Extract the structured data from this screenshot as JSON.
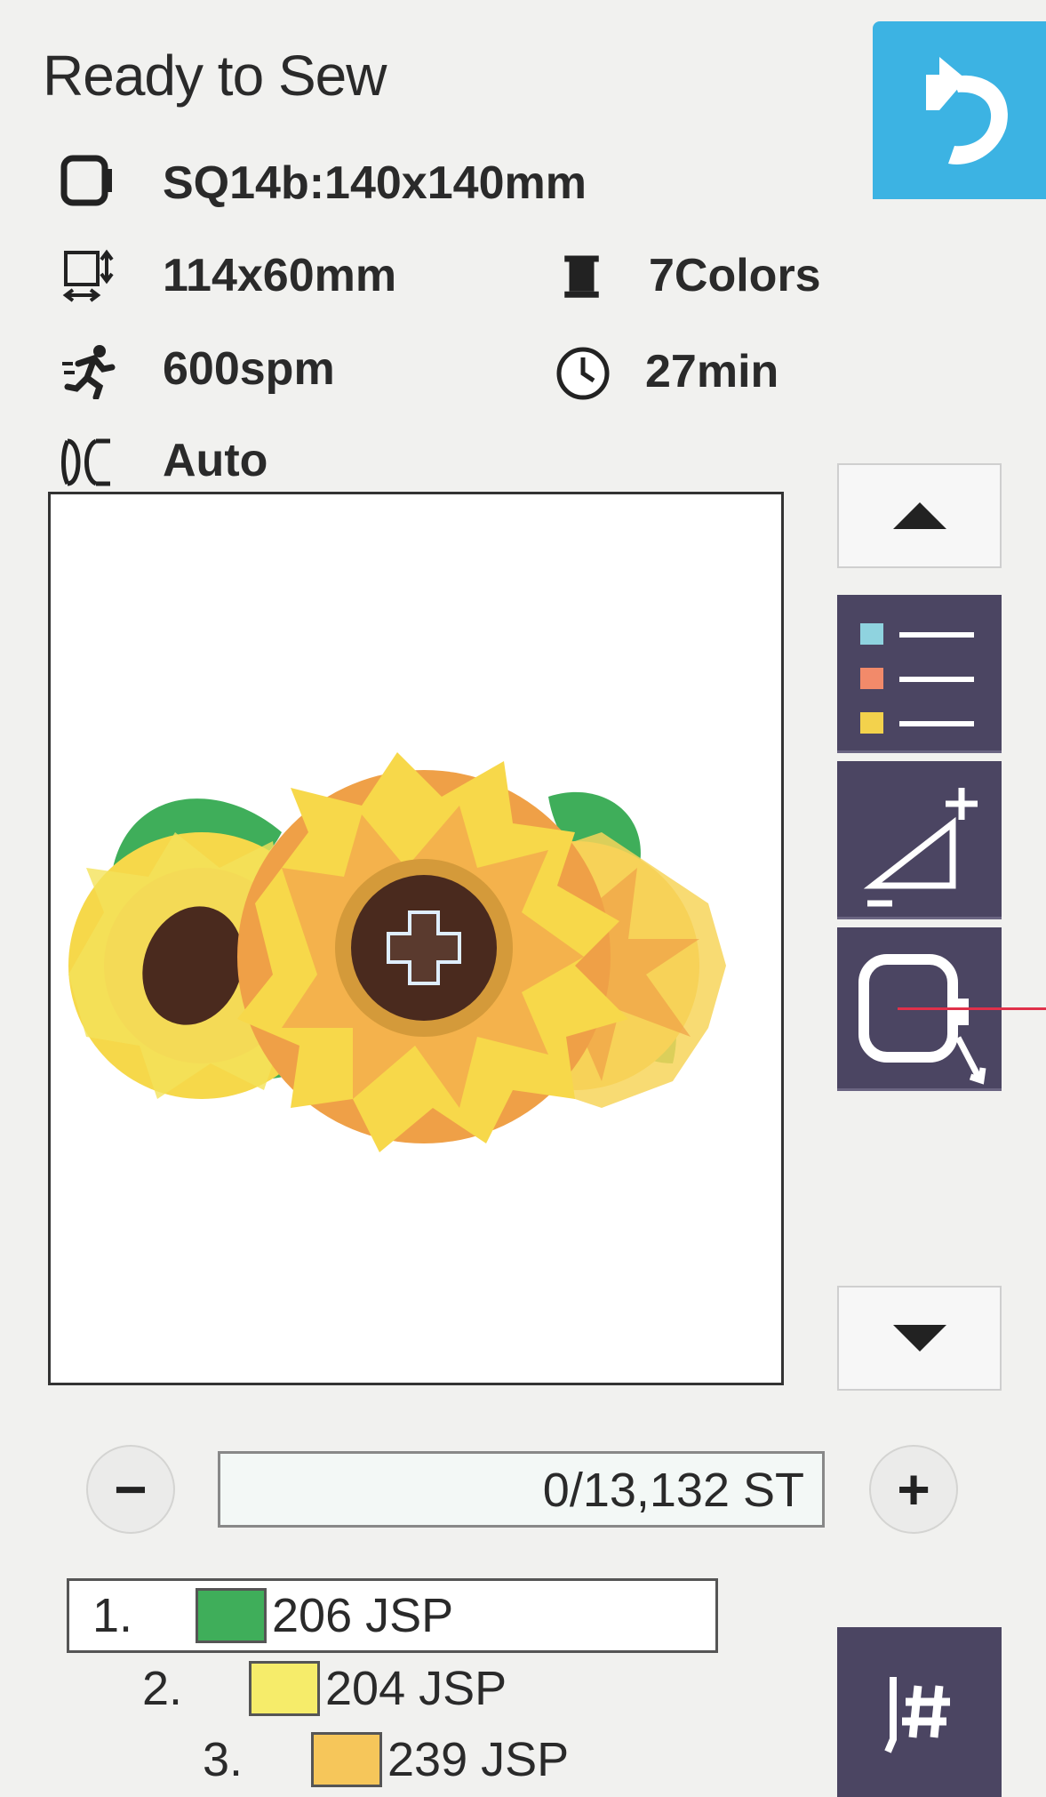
{
  "screen": {
    "title": "Ready to Sew"
  },
  "info": {
    "hoop": "SQ14b:140x140mm",
    "design_size": "114x60mm",
    "colors": "7Colors",
    "speed": "600spm",
    "time": "27min",
    "thread_cut": "Auto"
  },
  "stitch_counter": {
    "value": "0/13,132 ST",
    "minus_label": "−",
    "plus_label": "+"
  },
  "thread_list": [
    {
      "index": "1.",
      "code": "206 JSP",
      "color": "#3fae5a",
      "selected": true
    },
    {
      "index": "2.",
      "code": "204 JSP",
      "color": "#f6ec6a",
      "selected": false
    },
    {
      "index": "3.",
      "code": "239 JSP",
      "color": "#f6c65a",
      "selected": false
    }
  ],
  "colors": {
    "back_button": "#3cb3e3",
    "tool_button": "#4b4562",
    "leaf_green": "#3fae5a",
    "petal_yellow": "#f6d84a",
    "petal_orange": "#efa047",
    "center_brown": "#4a2a1e"
  },
  "icons": {
    "back": "return-arrow-icon",
    "hoop": "hoop-icon",
    "size": "design-size-icon",
    "spool": "thread-spool-icon",
    "speed": "running-man-icon",
    "clock": "clock-icon",
    "cut": "scissors-icon",
    "color_list": "color-list-icon",
    "resize": "resize-icon",
    "hoop_move": "hoop-move-icon",
    "stitch_jump": "stitch-jump-icon"
  }
}
